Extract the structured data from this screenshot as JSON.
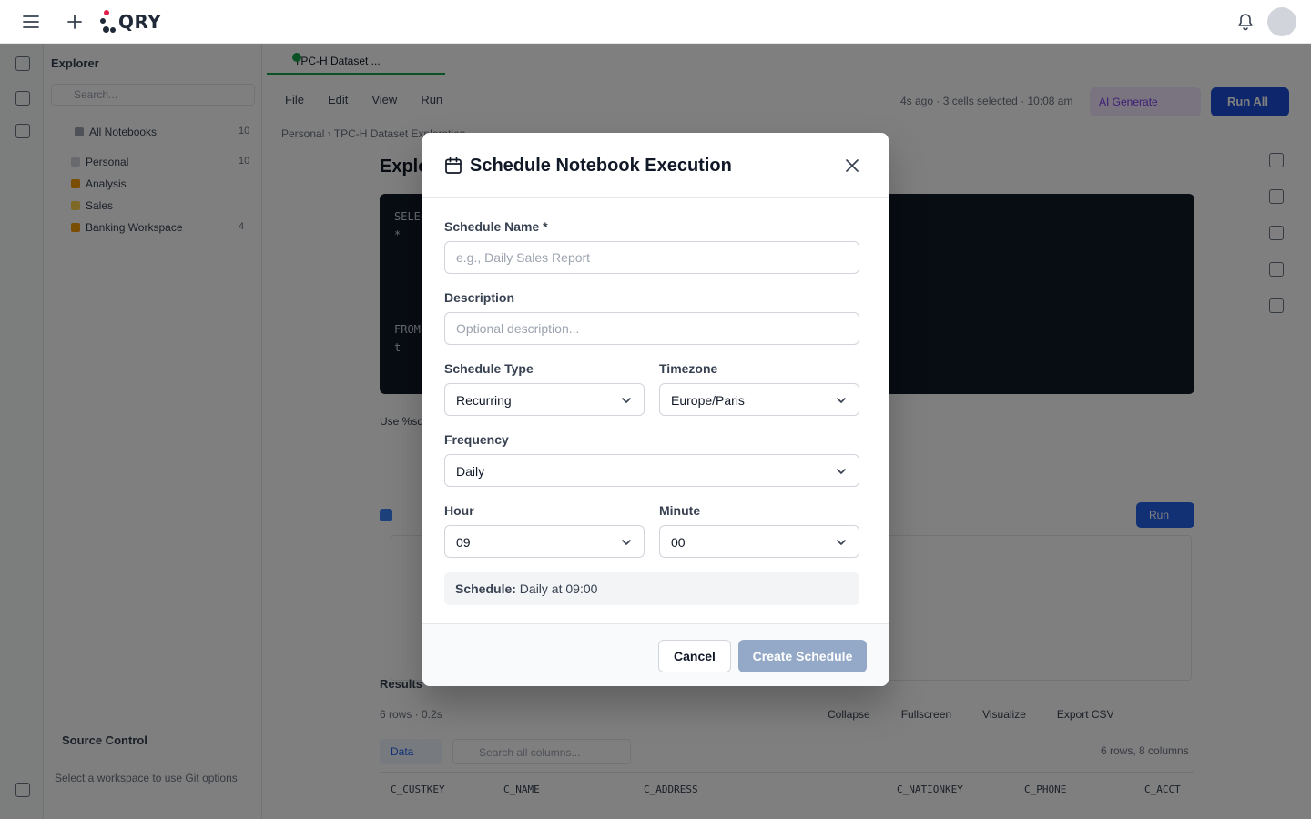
{
  "app": {
    "logo_text": "QRY"
  },
  "background": {
    "explorer_title": "Explorer",
    "search_placeholder": "Search...",
    "tree": [
      {
        "label": "All Notebooks",
        "count": "10"
      },
      {
        "label": "Personal",
        "count": "10"
      },
      {
        "label": "Analysis"
      },
      {
        "label": "Sales"
      },
      {
        "label": "Banking Workspace",
        "count": "4"
      }
    ],
    "source_control_title": "Source Control",
    "source_control_hint": "Select a workspace to use Git options",
    "tab_title": "TPC-H Dataset ...",
    "menu": [
      "File",
      "Edit",
      "View",
      "Run"
    ],
    "status_text": "4s ago · 3 cells selected · 10:08 am",
    "ai_label": "AI Generate",
    "run_all_label": "Run All",
    "breadcrumbs": "Personal  ›  TPC-H Dataset Exploration",
    "notebook_title": "Explo",
    "code_lines": [
      "SELECT",
      "  *",
      "FROM",
      "  t"
    ],
    "cell_hint": "Use %sql",
    "run_label": "Run",
    "results_title": "Results",
    "results_meta": "6 rows · 0.2s",
    "result_actions": [
      "Collapse",
      "Fullscreen",
      "Visualize",
      "Export CSV"
    ],
    "data_tab": "Data",
    "data_search_placeholder": "Search all columns...",
    "row_count": "6 rows, 8 columns",
    "columns": [
      "C_CUSTKEY",
      "C_NAME",
      "C_ADDRESS",
      "C_NATIONKEY",
      "C_PHONE",
      "C_ACCT"
    ]
  },
  "modal": {
    "title": "Schedule Notebook Execution",
    "icon": "calendar-icon",
    "schedule_name": {
      "label": "Schedule Name *",
      "value": "",
      "placeholder": "e.g., Daily Sales Report"
    },
    "description": {
      "label": "Description",
      "value": "",
      "placeholder": "Optional description..."
    },
    "schedule_type": {
      "label": "Schedule Type",
      "value": "Recurring"
    },
    "timezone": {
      "label": "Timezone",
      "value": "Europe/Paris"
    },
    "frequency": {
      "label": "Frequency",
      "value": "Daily"
    },
    "hour": {
      "label": "Hour",
      "value": "09"
    },
    "minute": {
      "label": "Minute",
      "value": "00"
    },
    "summary": {
      "label": "Schedule:",
      "text": "Daily at 09:00"
    },
    "cancel_label": "Cancel",
    "create_label": "Create Schedule"
  },
  "colors": {
    "overlay": "rgba(0,0,0,0.5)",
    "primary_disabled": "#93a9c7",
    "primary": "#1d4ed8",
    "accent_green": "#16a34a"
  }
}
